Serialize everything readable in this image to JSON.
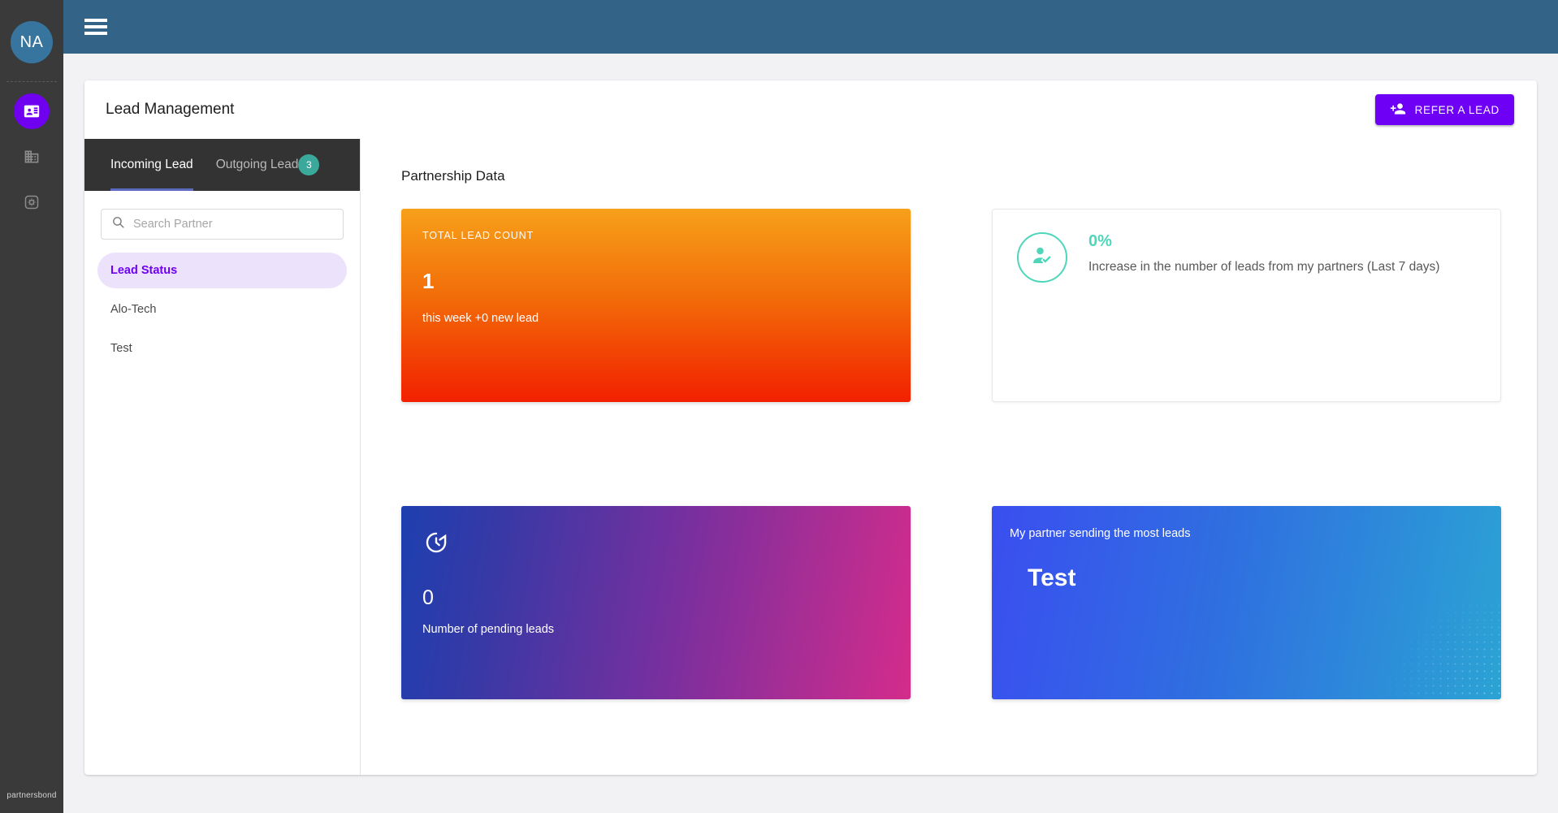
{
  "rail": {
    "avatar_initials": "NA",
    "items": [
      {
        "name": "contact-card-icon",
        "active": true
      },
      {
        "name": "building-icon",
        "active": false
      },
      {
        "name": "settings-gear-icon",
        "active": false
      }
    ],
    "brand": "partnersbond"
  },
  "topbar": {
    "menu_icon": "hamburger-menu-icon"
  },
  "header": {
    "title": "Lead Management",
    "refer_button_label": "REFER A LEAD",
    "refer_button_icon": "person-add-icon",
    "accent_purple": "#6d00f5"
  },
  "tabs": [
    {
      "label": "Incoming Lead",
      "active": true
    },
    {
      "label": "Outgoing Lead",
      "active": false
    }
  ],
  "tab_badge": {
    "value": "3",
    "color": "#3aa89b"
  },
  "search": {
    "icon": "search-icon",
    "value": "",
    "placeholder": "Search Partner"
  },
  "partners": [
    {
      "label": "Lead Status",
      "selected": true
    },
    {
      "label": "Alo-Tech",
      "selected": false
    },
    {
      "label": "Test",
      "selected": false
    }
  ],
  "main": {
    "section_title": "Partnership Data",
    "total_lead": {
      "label": "TOTAL LEAD COUNT",
      "value": "1",
      "sub": "this week +0 new lead",
      "gradient_from": "#f7a01a",
      "gradient_to": "#f22000"
    },
    "increase": {
      "icon": "person-check-icon",
      "percent": "0%",
      "description": "Increase in the number of leads from my partners (Last 7 days)",
      "accent": "#4ed6bb"
    },
    "pending": {
      "icon": "history-clock-icon",
      "value": "0",
      "label": "Number of pending leads",
      "gradient_from": "#1e3fb0",
      "gradient_to": "#d42c8b"
    },
    "top_partner": {
      "label": "My partner sending the most leads",
      "name": "Test",
      "gradient_from": "#3a4ef0",
      "gradient_to": "#2ba3d4"
    }
  }
}
